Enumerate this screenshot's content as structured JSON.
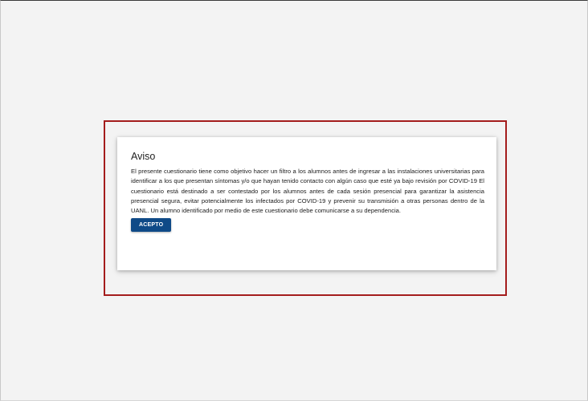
{
  "dialog": {
    "title": "Aviso",
    "body": "El presente cuestionario tiene como objetivo hacer un filtro a los alumnos antes de ingresar a las instalaciones universitarias para identificar a los que presentan síntomas y/o que hayan tenido contacto con algún caso que esté ya bajo revisión por COVID-19 El cuestionario está destinado a ser contestado por los alumnos antes de cada sesión presencial para garantizar la asistencia presencial segura, evitar potencialmente los infectados por COVID-19 y prevenir su transmisión a otras personas dentro de la UANL. Un alumno identificado por medio de este cuestionario debe comunicarse a su dependencia.",
    "accept_label": "ACEPTO"
  },
  "colors": {
    "highlight_border": "#a41c1c",
    "button_bg": "#0f4a87",
    "page_bg": "#f3f3f3"
  }
}
